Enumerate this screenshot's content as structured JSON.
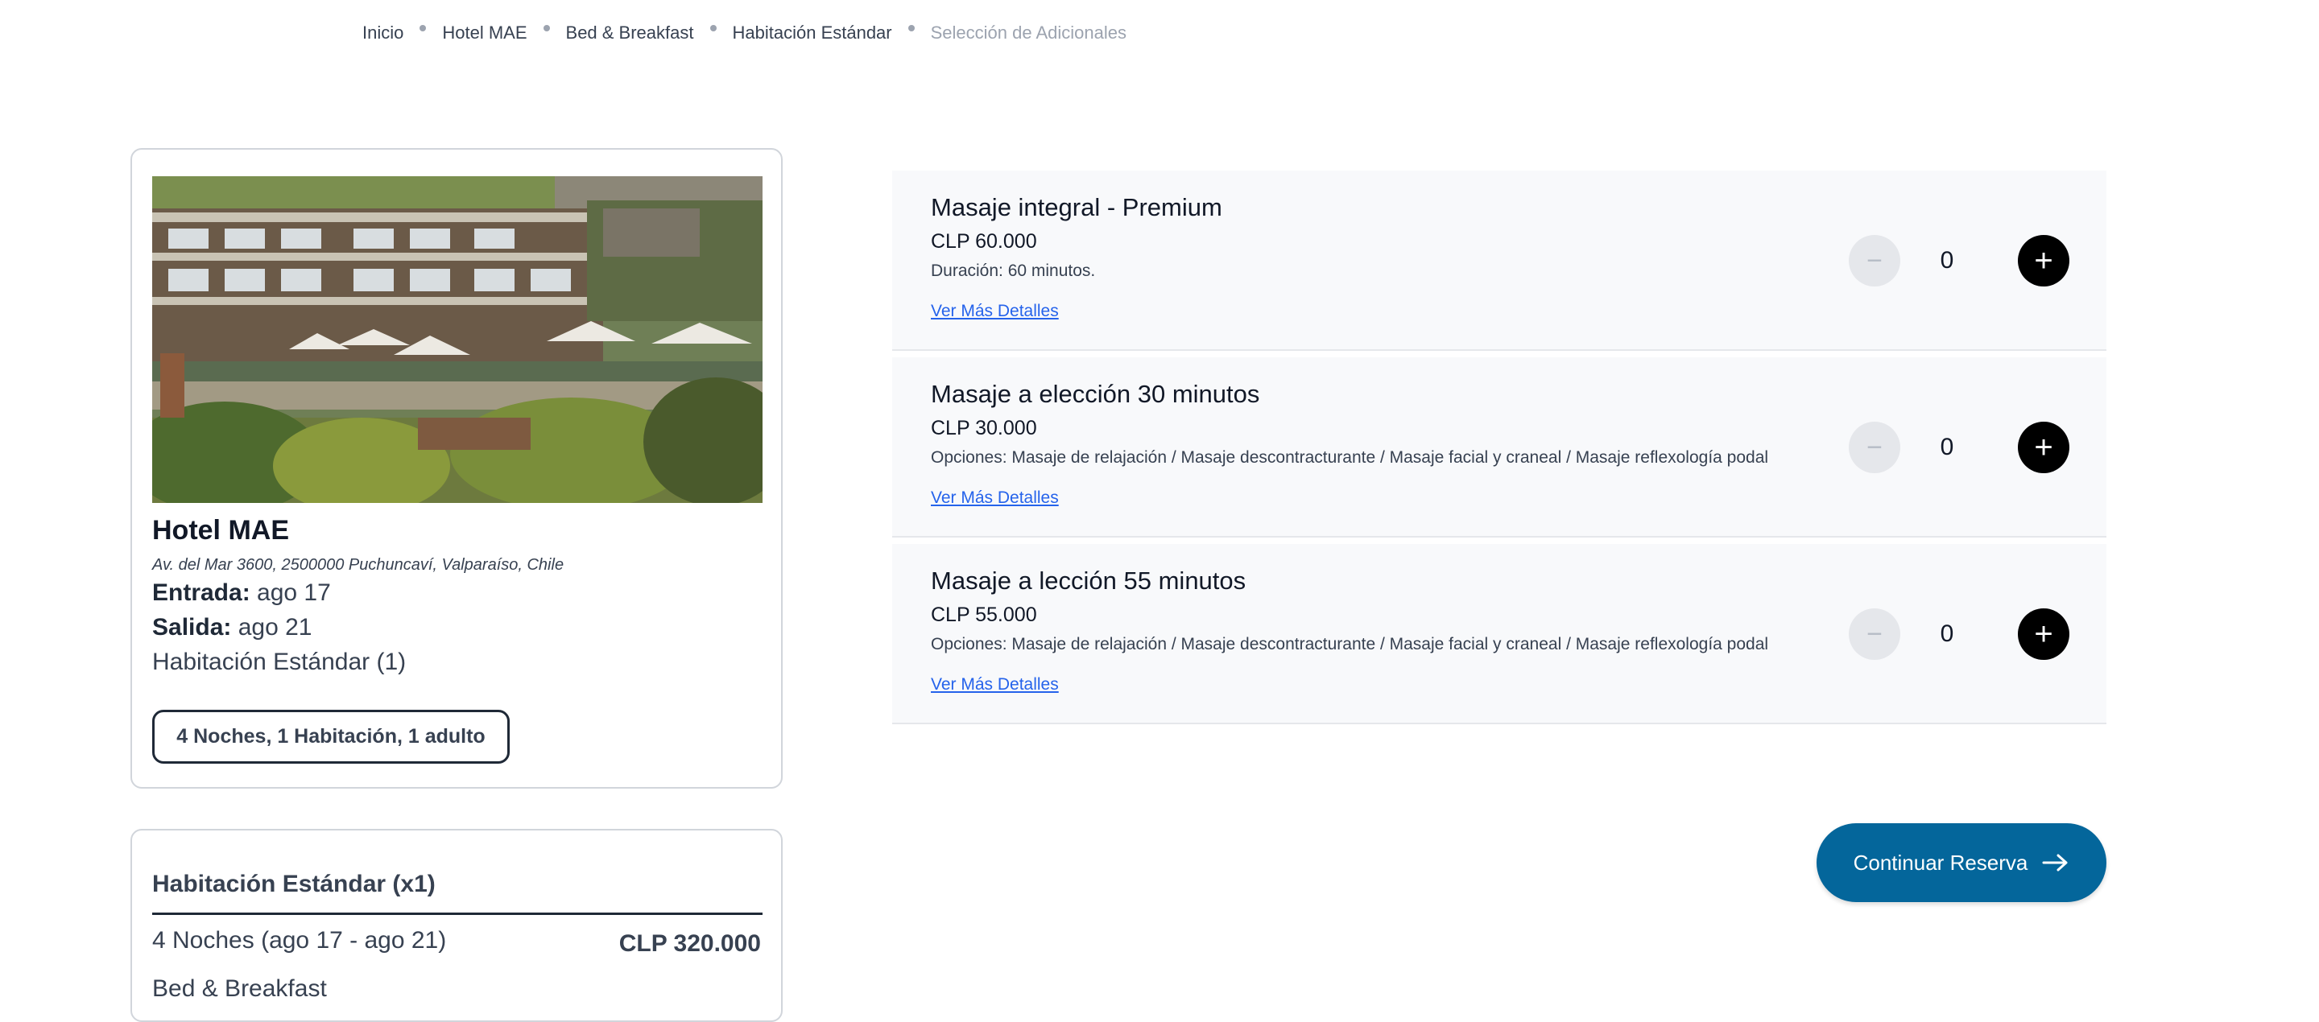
{
  "breadcrumb": {
    "items": [
      "Inicio",
      "Hotel MAE",
      "Bed & Breakfast",
      "Habitación Estándar"
    ],
    "current": "Selección de Adicionales"
  },
  "hotel": {
    "name": "Hotel MAE",
    "address": "Av. del Mar 3600, 2500000 Puchuncaví, Valparaíso, Chile",
    "checkin_label": "Entrada:",
    "checkin_value": "ago 17",
    "checkout_label": "Salida:",
    "checkout_value": "ago 21",
    "room": "Habitación Estándar (1)",
    "summary_button": "4 Noches, 1 Habitación, 1 adulto"
  },
  "price_summary": {
    "title": "Habitación Estándar (x1)",
    "nights": "4 Noches (ago 17 - ago 21)",
    "amount": "CLP 320.000",
    "plan": "Bed & Breakfast"
  },
  "addons": [
    {
      "name": "Masaje integral - Premium",
      "price": "CLP 60.000",
      "description": "Duración: 60 minutos.",
      "link": "Ver Más Detalles",
      "quantity": "0",
      "minus": "−",
      "plus": "+"
    },
    {
      "name": "Masaje a elección 30 minutos",
      "price": "CLP 30.000",
      "description": "Opciones: Masaje de relajación / Masaje descontracturante / Masaje facial y craneal / Masaje reflexología podal",
      "link": "Ver Más Detalles",
      "quantity": "0",
      "minus": "−",
      "plus": "+"
    },
    {
      "name": "Masaje a lección 55 minutos",
      "price": "CLP 55.000",
      "description": "Opciones: Masaje de relajación / Masaje descontracturante / Masaje facial y craneal / Masaje reflexología podal",
      "link": "Ver Más Detalles",
      "quantity": "0",
      "minus": "−",
      "plus": "+"
    }
  ],
  "continue_button": "Continuar Reserva",
  "colors": {
    "primary": "#04669b",
    "link": "#2563eb",
    "addon_bg": "#f8f9fb"
  },
  "icons": [
    "minus-icon",
    "plus-icon",
    "arrow-right-icon"
  ]
}
